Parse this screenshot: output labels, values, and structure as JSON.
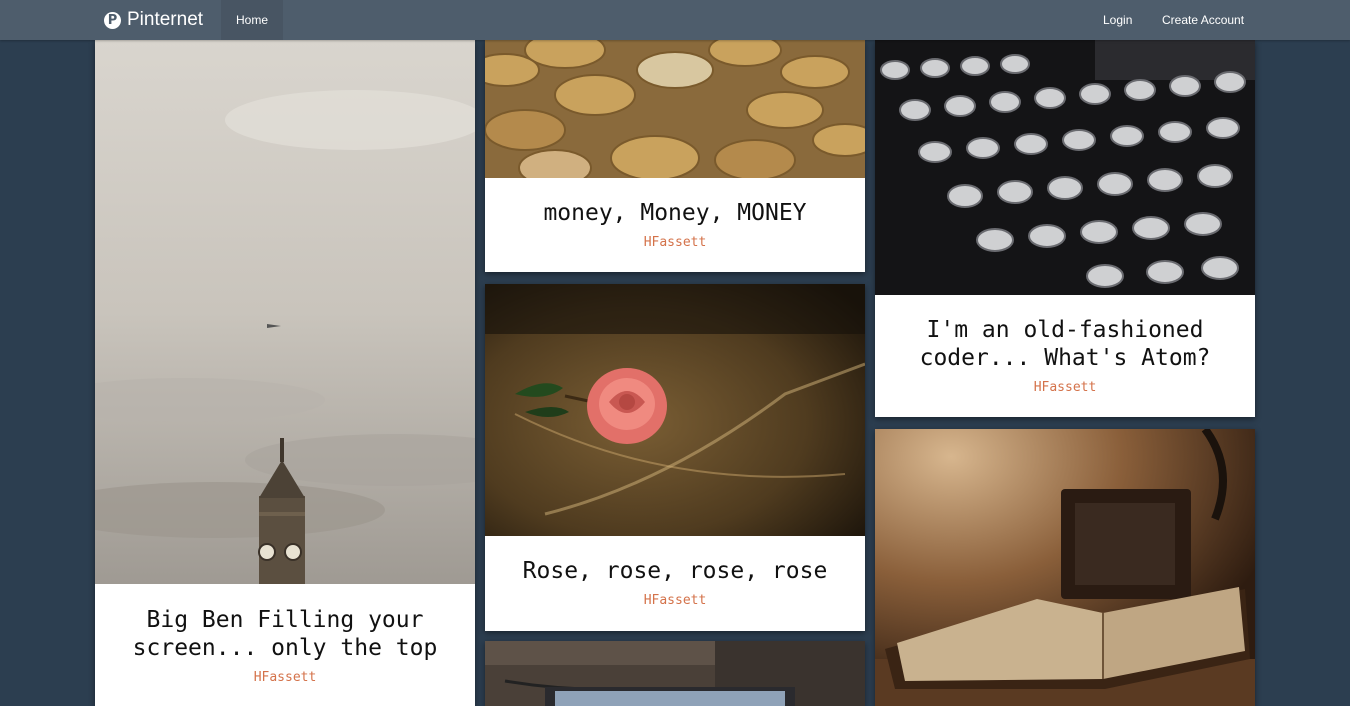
{
  "nav": {
    "brand": "Pinternet",
    "home": "Home",
    "login": "Login",
    "create_account": "Create Account"
  },
  "pins": [
    {
      "title": "Big Ben Filling your screen... only the top",
      "author": "HFassett"
    },
    {
      "title": "money, Money, MONEY",
      "author": "HFassett"
    },
    {
      "title": "Rose, rose, rose, rose",
      "author": "HFassett"
    },
    {
      "title": "I'm an old-fashioned coder... What's Atom?",
      "author": "HFassett"
    }
  ],
  "colors": {
    "background": "#2c3e50",
    "navbar": "#4e5d6c",
    "author_accent": "#d4724a"
  }
}
